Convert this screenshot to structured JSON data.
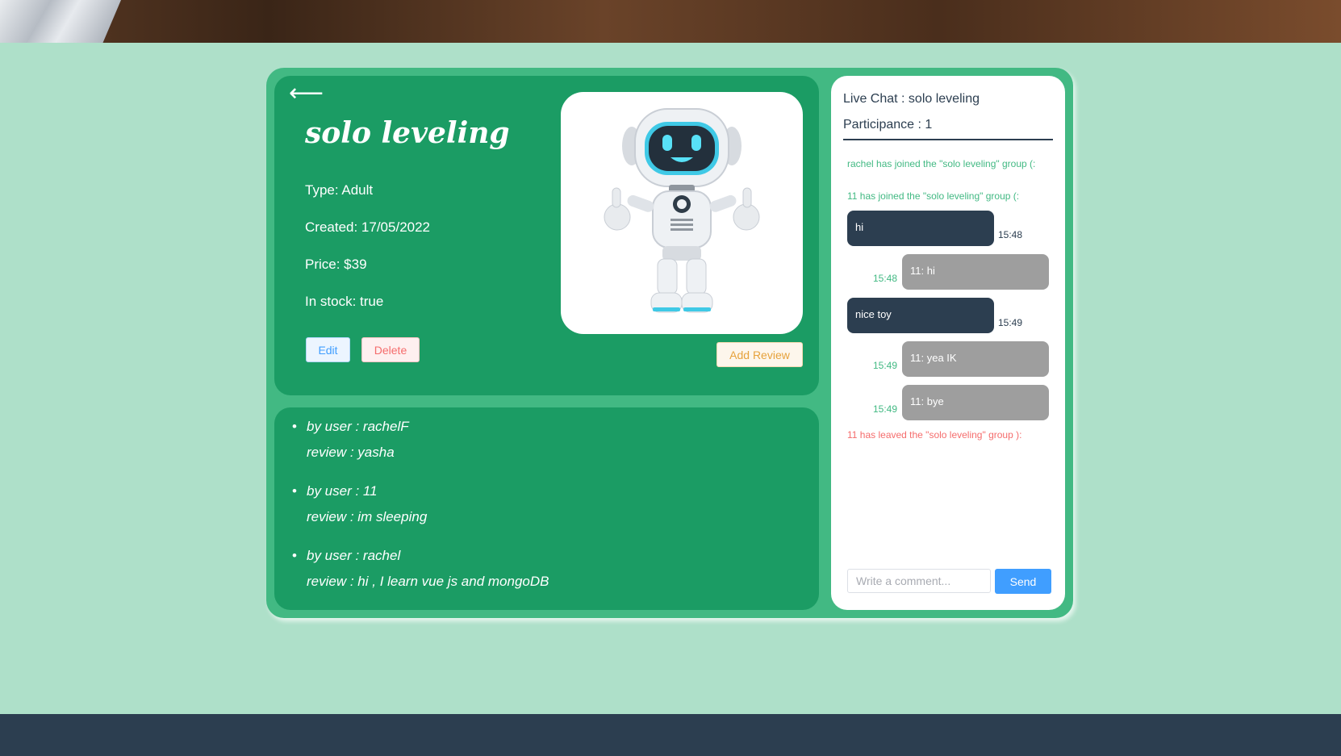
{
  "toy": {
    "back_icon": "left-arrow-icon",
    "name": "solo leveling",
    "type_line": "Type: Adult",
    "created_line": "Created: 17/05/2022",
    "price_line": "Price: $39",
    "stock_line": "In stock: true",
    "edit_label": "Edit",
    "delete_label": "Delete",
    "add_review_label": "Add Review",
    "image_icon": "robot-toy-image"
  },
  "reviews": [
    {
      "user_line": "by user : rachelF",
      "review_line": "review : yasha"
    },
    {
      "user_line": "by user : 11",
      "review_line": "review : im sleeping"
    },
    {
      "user_line": "by user : rachel",
      "review_line": "review : hi , I learn vue js and mongoDB"
    }
  ],
  "chat": {
    "title": "Live Chat : solo leveling",
    "participants": "Participance : 1",
    "system_join_1": "rachel has joined the \"solo leveling\" group (:",
    "system_join_2": "11 has joined the \"solo leveling\" group (:",
    "messages": [
      {
        "text": "hi",
        "time": "15:48",
        "own": true
      },
      {
        "text": "11: hi",
        "time": "15:48",
        "own": false
      },
      {
        "text": "nice toy",
        "time": "15:49",
        "own": true
      },
      {
        "text": "11: yea IK",
        "time": "15:49",
        "own": false
      },
      {
        "text": "11: bye",
        "time": "15:49",
        "own": false
      }
    ],
    "system_leave": "11 has leaved the \"solo leveling\" group ):",
    "input_placeholder": "Write a comment...",
    "send_label": "Send"
  },
  "colors": {
    "page_bg": "#aee0c9",
    "card_accent": "#42b983",
    "panel_green": "#1b9c64",
    "dark": "#2c3e50",
    "primary_blue": "#409eff"
  }
}
